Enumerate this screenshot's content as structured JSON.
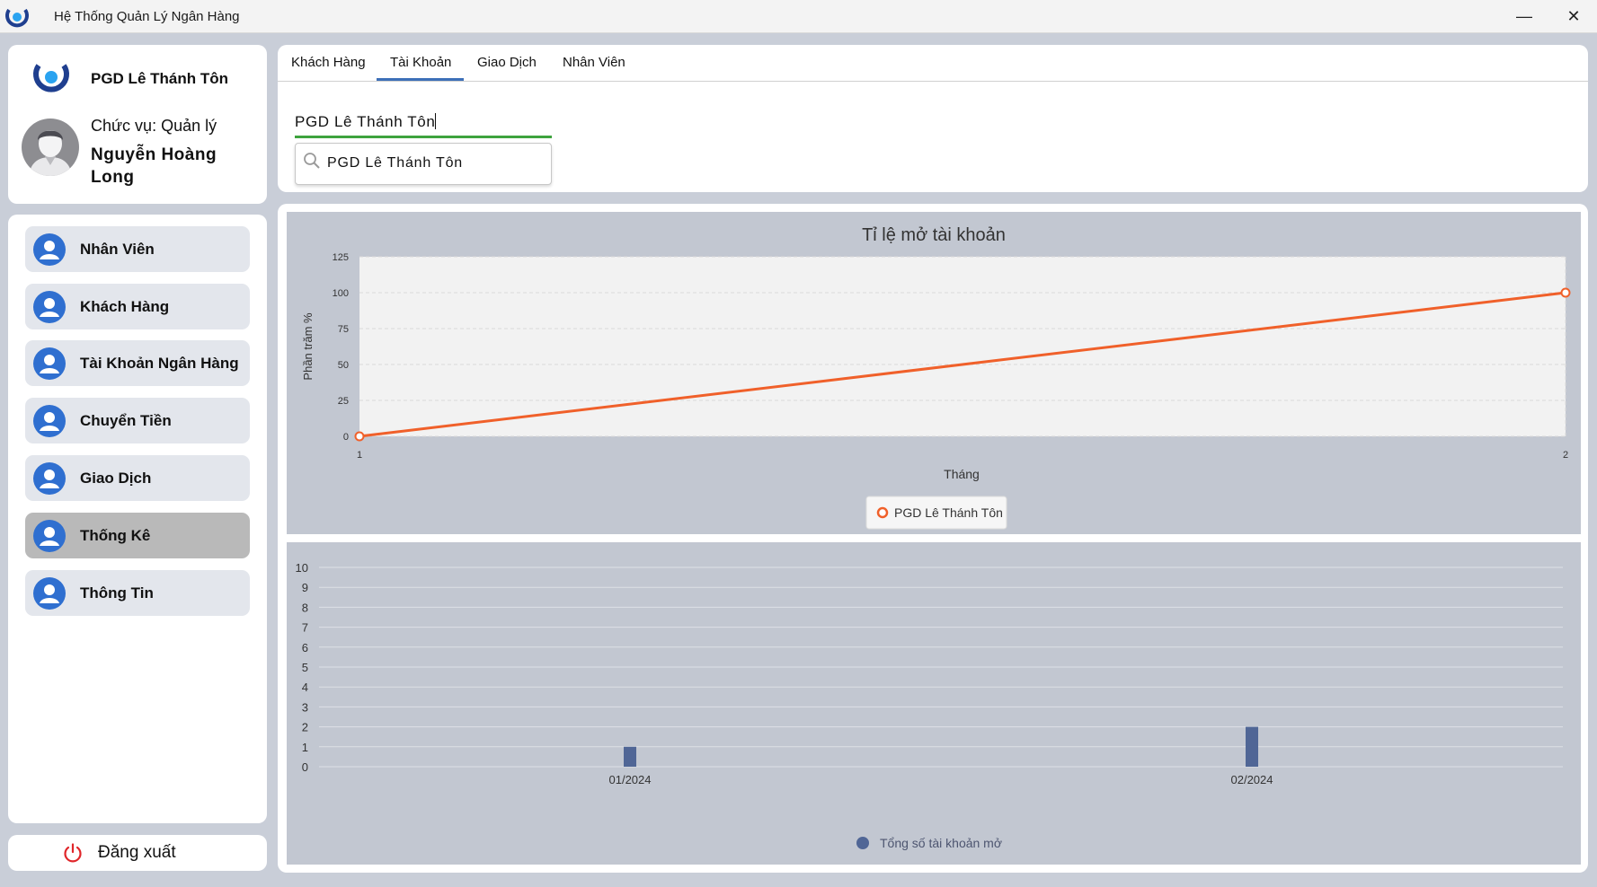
{
  "window": {
    "title": "Hệ Thống Quản Lý Ngân Hàng",
    "minimize_glyph": "—",
    "close_glyph": "✕"
  },
  "profile": {
    "branch": "PGD Lê Thánh Tôn",
    "role": "Chức vụ: Quản lý",
    "name": "Nguyễn Hoàng Long"
  },
  "sidebar": {
    "items": [
      {
        "label": "Nhân Viên",
        "icon": "user-icon",
        "active": false
      },
      {
        "label": "Khách Hàng",
        "icon": "user-icon",
        "active": false
      },
      {
        "label": "Tài Khoản Ngân Hàng",
        "icon": "user-icon",
        "active": false
      },
      {
        "label": "Chuyển Tiền",
        "icon": "user-icon",
        "active": false
      },
      {
        "label": "Giao Dịch",
        "icon": "user-icon",
        "active": false
      },
      {
        "label": "Thống Kê",
        "icon": "user-icon",
        "active": true
      },
      {
        "label": "Thông Tin",
        "icon": "user-icon",
        "active": false
      }
    ],
    "logout_label": "Đăng xuất"
  },
  "tabs": [
    {
      "label": "Khách Hàng"
    },
    {
      "label": "Tài Khoản"
    },
    {
      "label": "Giao Dịch"
    },
    {
      "label": "Nhân Viên"
    }
  ],
  "active_tab": "Tài Khoản",
  "filter": {
    "selected": "PGD Lê Thánh Tôn",
    "search_text": "PGD Lê Thánh Tôn"
  },
  "colors": {
    "accent": "#3d6fb8",
    "line_series": "#f0602a",
    "bar_series": "#506696",
    "active_nav": "#b9b9b9",
    "combo_underline": "#3ea33e"
  },
  "chart_data": [
    {
      "type": "line",
      "title": "Tỉ lệ mở tài khoản",
      "xlabel": "Tháng",
      "ylabel": "Phần trăm %",
      "x": [
        1,
        2
      ],
      "xlim": [
        1,
        2
      ],
      "ylim": [
        0,
        125
      ],
      "yticks": [
        0,
        25,
        50,
        75,
        100,
        125
      ],
      "series": [
        {
          "name": "PGD Lê Thánh Tôn",
          "values": [
            0,
            100
          ]
        }
      ],
      "legend": "bottom",
      "grid": true
    },
    {
      "type": "bar",
      "categories": [
        "01/2024",
        "02/2024"
      ],
      "ylim": [
        0,
        10
      ],
      "yticks": [
        0,
        1,
        2,
        3,
        4,
        5,
        6,
        7,
        8,
        9,
        10
      ],
      "series": [
        {
          "name": "Tổng số tài khoản mở",
          "values": [
            1,
            2
          ]
        }
      ],
      "legend": "bottom",
      "grid": true
    }
  ]
}
